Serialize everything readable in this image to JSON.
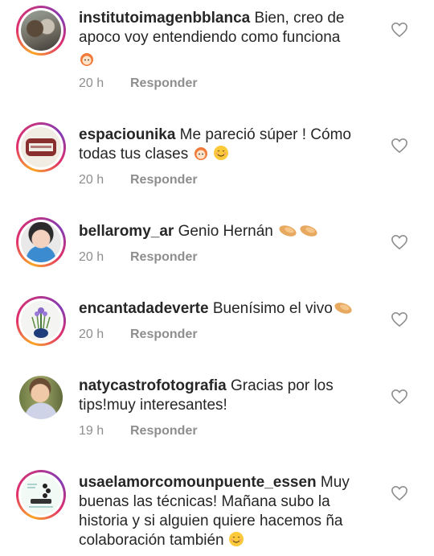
{
  "comments": [
    {
      "username": "institutoimagenbblanca",
      "text": " Bien, creo  de apoco voy entendiendo  como funciona ",
      "emojis": [
        "person-face-emoji"
      ],
      "time": "20 h",
      "reply_label": "Responder",
      "avatar": "ring"
    },
    {
      "username": "espaciounika",
      "text": " Me pareció súper ! Cómo todas tus clases ",
      "emojis": [
        "person-face-emoji",
        "smiling-face-emoji"
      ],
      "time": "20 h",
      "reply_label": "Responder",
      "avatar": "ring"
    },
    {
      "username": "bellaromy_ar",
      "text": " Genio Hernán ",
      "emojis": [
        "clapping-hands-emoji",
        "clapping-hands-emoji"
      ],
      "time": "20 h",
      "reply_label": "Responder",
      "avatar": "ring"
    },
    {
      "username": "encantadadeverte",
      "text": " Buenísimo el vivo",
      "emojis": [
        "clapping-hands-emoji"
      ],
      "time": "20 h",
      "reply_label": "Responder",
      "avatar": "ring"
    },
    {
      "username": "natycastrofotografia",
      "text": " Gracias por los tips!muy interesantes!",
      "emojis": [],
      "time": "19 h",
      "reply_label": "Responder",
      "avatar": "plain"
    },
    {
      "username": "usaelamorcomounpuente_essen",
      "text": " Muy buenas las técnicas! Mañana subo la historia y si alguien quiere hacemos ña colaboración también ",
      "emojis": [
        "smiling-face-emoji"
      ],
      "time": "",
      "reply_label": "",
      "avatar": "ring"
    }
  ],
  "colors": {
    "text": "#262626",
    "muted": "#8e8e8e",
    "ring_gradient": [
      "#f9a825",
      "#e1306c",
      "#c13584",
      "#833ab4"
    ]
  }
}
